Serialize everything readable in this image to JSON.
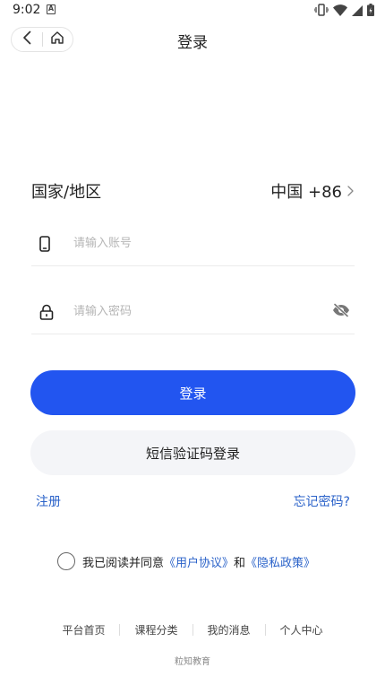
{
  "status_bar": {
    "time": "9:02",
    "notification_letter": "A"
  },
  "header": {
    "title": "登录"
  },
  "region": {
    "label": "国家/地区",
    "value": "中国 +86"
  },
  "account": {
    "placeholder": "请输入账号",
    "value": ""
  },
  "password": {
    "placeholder": "请输入密码",
    "value": ""
  },
  "buttons": {
    "login": "登录",
    "sms_login": "短信验证码登录"
  },
  "links": {
    "register": "注册",
    "forgot": "忘记密码?"
  },
  "agreement": {
    "prefix": "我已阅读并同意",
    "user_agreement": "《用户协议》",
    "and": "和",
    "privacy_policy": "《隐私政策》"
  },
  "footer": {
    "items": [
      "平台首页",
      "课程分类",
      "我的消息",
      "个人中心"
    ],
    "brand": "粒知教育"
  },
  "colors": {
    "accent": "#2255f0",
    "link": "#2a62c9",
    "secondary_bg": "#f4f5f8"
  },
  "icons": {
    "back": "back-arrow-icon",
    "home": "home-icon",
    "phone": "phone-icon",
    "lock": "lock-icon",
    "eye": "eye-off-icon",
    "chevron": "chevron-right-icon"
  }
}
